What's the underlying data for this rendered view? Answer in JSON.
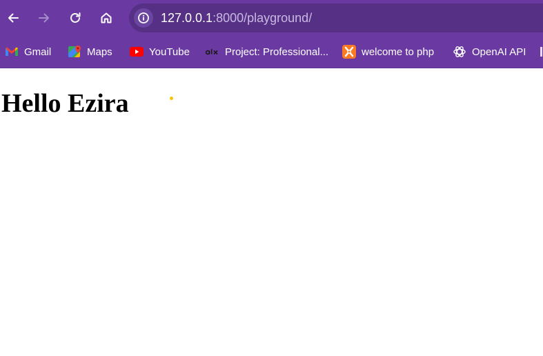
{
  "browser": {
    "accent_color": "#6a3aa2",
    "address_bar_color": "#553085",
    "nav": {
      "back_icon": "arrow-left-icon",
      "forward_icon": "arrow-right-icon",
      "reload_icon": "reload-icon",
      "home_icon": "home-icon"
    },
    "address": {
      "site_info_icon": "info-icon",
      "url_host": "127.0.0.1",
      "url_rest": ":8000/playground/"
    },
    "bookmarks": [
      {
        "label": "Gmail",
        "icon": "gmail-icon"
      },
      {
        "label": "Maps",
        "icon": "google-maps-icon"
      },
      {
        "label": "YouTube",
        "icon": "youtube-icon"
      },
      {
        "label": "Project: Professional...",
        "icon": "alx-icon"
      },
      {
        "label": "welcome to php",
        "icon": "xampp-icon"
      },
      {
        "label": "OpenAI API",
        "icon": "openai-icon"
      }
    ]
  },
  "page": {
    "heading": "Hello Ezira"
  }
}
